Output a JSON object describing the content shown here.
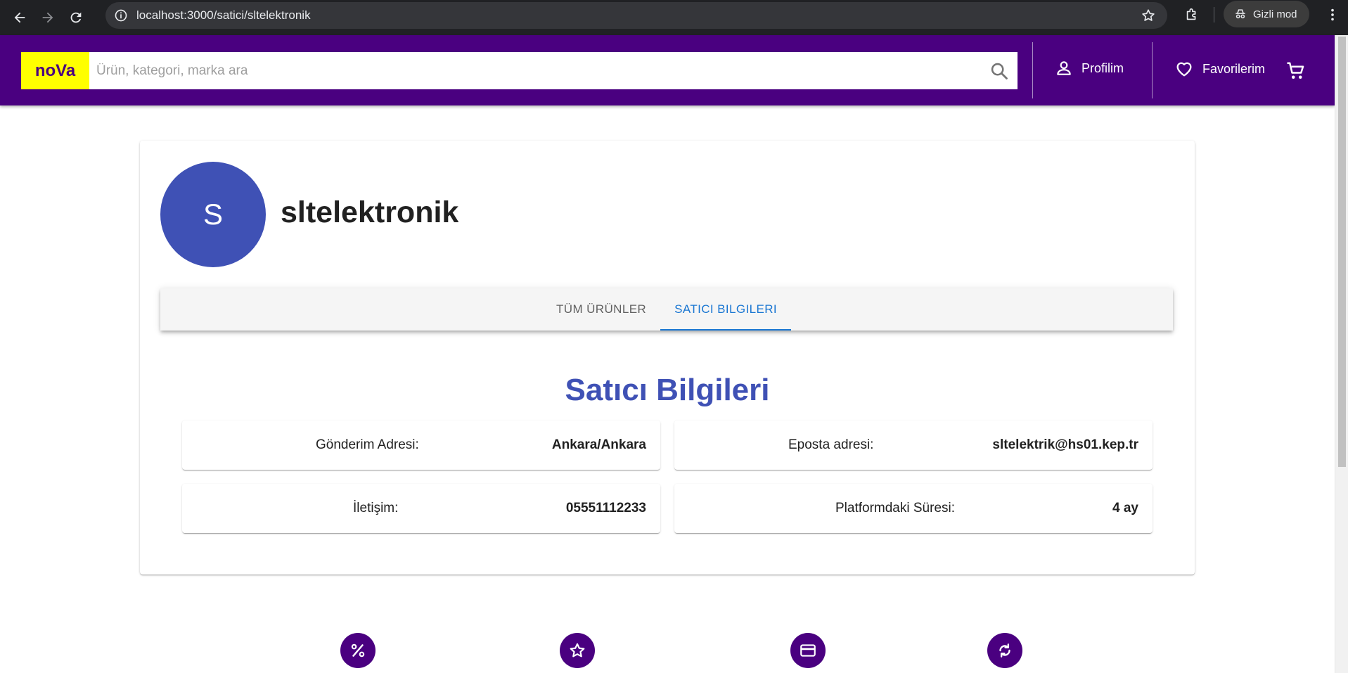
{
  "browser": {
    "url": "localhost:3000/satici/sltelektronik",
    "incognito_label": "Gizli mod"
  },
  "header": {
    "logo": "noVa",
    "search_placeholder": "Ürün, kategori, marka ara",
    "profile_label": "Profilim",
    "favorites_label": "Favorilerim"
  },
  "seller": {
    "avatar_letter": "S",
    "name": "sltelektronik"
  },
  "tabs": [
    {
      "label": "TÜM ÜRÜNLER",
      "active": false
    },
    {
      "label": "SATICI BILGILERI",
      "active": true
    }
  ],
  "section_title": "Satıcı Bilgileri",
  "info": {
    "shipping_address": {
      "label": "Gönderim Adresi:",
      "value": "Ankara/Ankara"
    },
    "email": {
      "label": "Eposta adresi:",
      "value": "sltelektrik@hs01.kep.tr"
    },
    "contact": {
      "label": "İletişim:",
      "value": "05551112233"
    },
    "platform_duration": {
      "label": "Platformdaki Süresi:",
      "value": "4 ay"
    }
  },
  "features": [
    "percent-icon",
    "star-icon",
    "credit-card-icon",
    "refresh-icon"
  ],
  "colors": {
    "header_bg": "#4a0080",
    "logo_bg": "#ffff00",
    "avatar_bg": "#3f51b5",
    "tab_active": "#1976d2",
    "title": "#3f51b5"
  }
}
